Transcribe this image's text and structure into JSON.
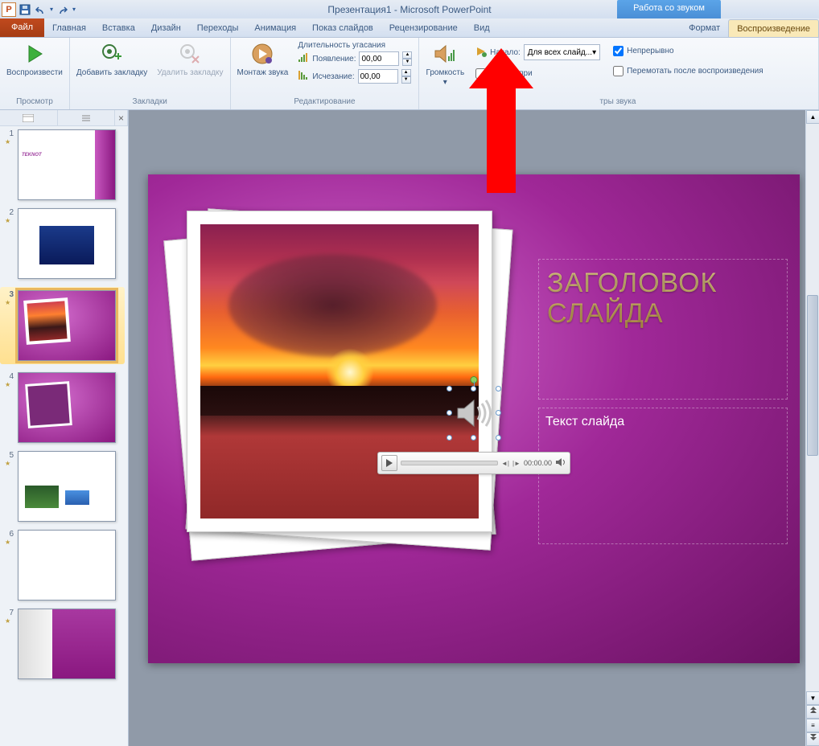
{
  "title_bar": {
    "app_title": "Презентация1 - Microsoft PowerPoint",
    "context_label": "Работа со звуком"
  },
  "tabs": {
    "file": "Файл",
    "home": "Главная",
    "insert": "Вставка",
    "design": "Дизайн",
    "transitions": "Переходы",
    "animations": "Анимация",
    "slideshow": "Показ слайдов",
    "review": "Рецензирование",
    "view": "Вид",
    "format": "Формат",
    "playback": "Воспроизведение"
  },
  "ribbon": {
    "preview": {
      "play": "Воспроизвести",
      "group": "Просмотр"
    },
    "bookmarks": {
      "add": "Добавить закладку",
      "remove": "Удалить закладку",
      "group": "Закладки"
    },
    "editing": {
      "trim": "Монтаж звука",
      "duration_label": "Длительность угасания",
      "fade_in": "Появление:",
      "fade_in_val": "00,00",
      "fade_out": "Исчезание:",
      "fade_out_val": "00,00",
      "group": "Редактирование"
    },
    "options": {
      "volume": "Громкость",
      "start_label": "Начало:",
      "start_value": "Для всех слайд...",
      "hide": "Скрыть при",
      "loop": "Непрерывно",
      "rewind": "Перемотать после воспроизведения",
      "group": "тры звука"
    }
  },
  "thumbnails": [
    {
      "n": "1"
    },
    {
      "n": "2"
    },
    {
      "n": "3"
    },
    {
      "n": "4"
    },
    {
      "n": "5"
    },
    {
      "n": "6"
    },
    {
      "n": "7"
    }
  ],
  "slide": {
    "title": "ЗАГОЛОВОК СЛАЙДА",
    "subtitle": "Текст слайда"
  },
  "player": {
    "time": "00:00.00"
  },
  "icons": {
    "play_triangle": "▶",
    "chevron_down": "▾",
    "up": "▲",
    "down": "▼",
    "close": "×",
    "prev": "◄",
    "next": "►"
  }
}
